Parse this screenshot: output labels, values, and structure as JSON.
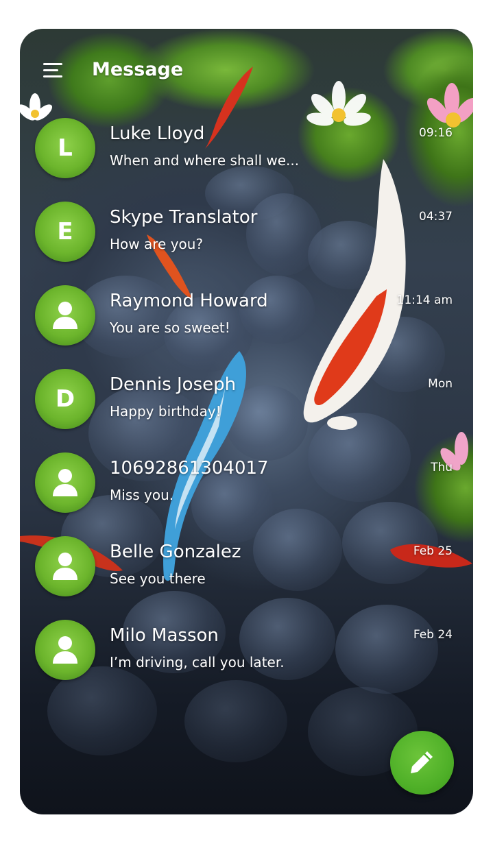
{
  "app": {
    "title": "Message"
  },
  "colors": {
    "accent": "#5dbb2f",
    "text": "#ffffff"
  },
  "header": {
    "menu_icon": "menu-icon"
  },
  "conversations": [
    {
      "avatar_type": "letter",
      "avatar_letter": "L",
      "name": "Luke Lloyd",
      "preview": "When and where shall we...",
      "time": "09:16"
    },
    {
      "avatar_type": "letter",
      "avatar_letter": "E",
      "name": "Skype Translator",
      "preview": "How are you?",
      "time": "04:37"
    },
    {
      "avatar_type": "person-icon",
      "avatar_letter": "",
      "name": "Raymond Howard",
      "preview": "You are so sweet!",
      "time": "11:14 am"
    },
    {
      "avatar_type": "letter",
      "avatar_letter": "D",
      "name": "Dennis Joseph",
      "preview": "Happy birthday!",
      "time": "Mon"
    },
    {
      "avatar_type": "person-icon",
      "avatar_letter": "",
      "name": "10692861304017",
      "preview": "Miss you.",
      "time": "Thu"
    },
    {
      "avatar_type": "person-icon",
      "avatar_letter": "",
      "name": "Belle Gonzalez",
      "preview": "See you there",
      "time": "Feb 25"
    },
    {
      "avatar_type": "person-icon",
      "avatar_letter": "",
      "name": "Milo Masson",
      "preview": "I’m driving, call you later.",
      "time": "Feb 24"
    }
  ],
  "fab": {
    "icon": "pencil-icon"
  }
}
